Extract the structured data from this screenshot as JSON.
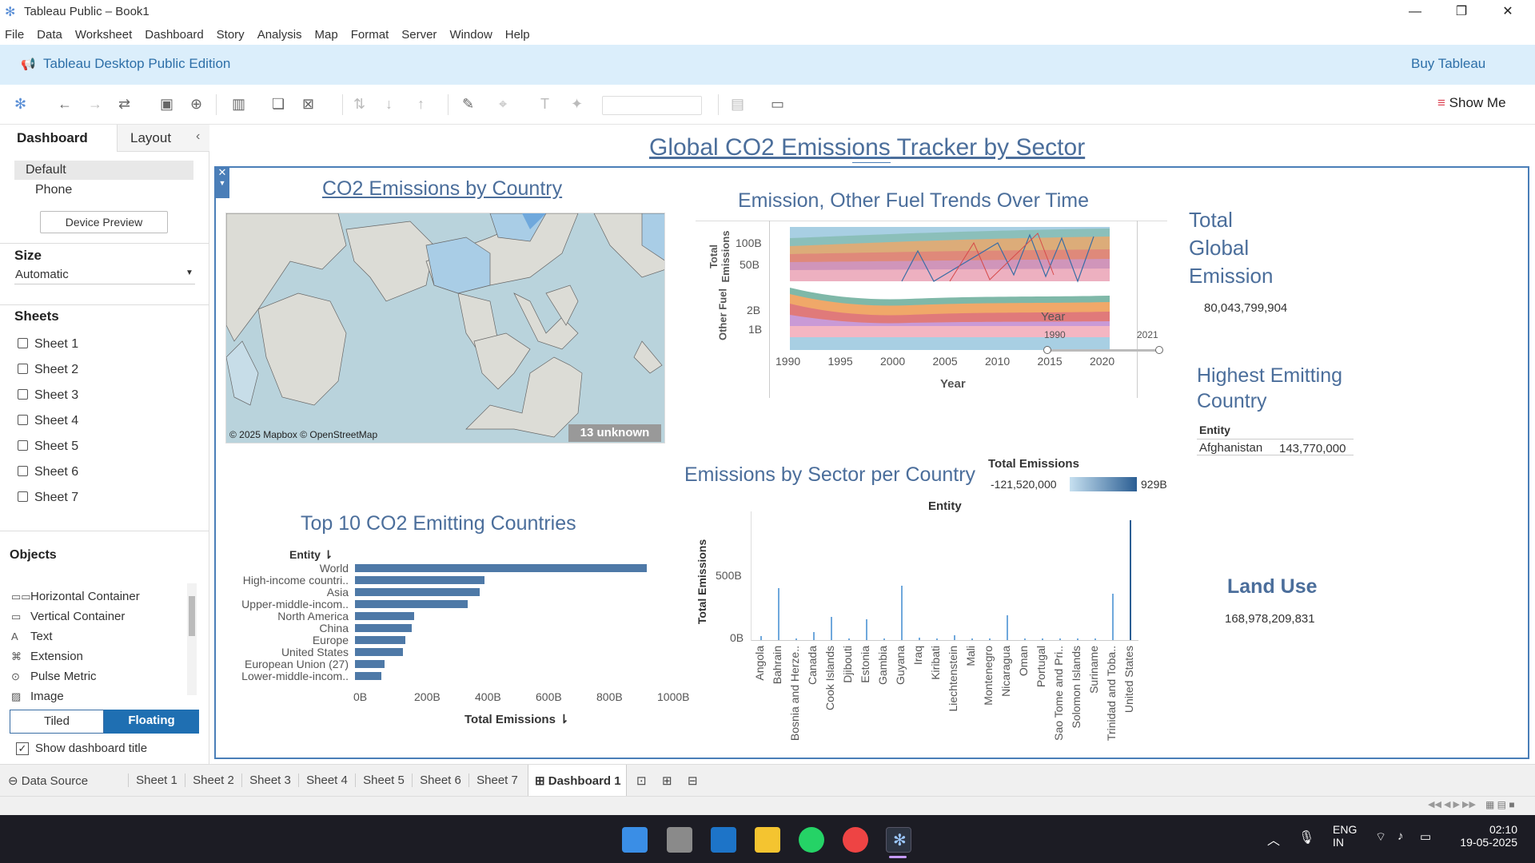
{
  "window": {
    "title": "Tableau Public – Book1"
  },
  "menu": [
    "File",
    "Data",
    "Worksheet",
    "Dashboard",
    "Story",
    "Analysis",
    "Map",
    "Format",
    "Server",
    "Window",
    "Help"
  ],
  "banner": {
    "edition": "Tableau Desktop Public Edition",
    "buy": "Buy Tableau"
  },
  "toolbar": {
    "show_me": "Show Me"
  },
  "left": {
    "tab_dashboard": "Dashboard",
    "tab_layout": "Layout",
    "devices": [
      "Default",
      "Phone"
    ],
    "device_preview": "Device Preview",
    "size_label": "Size",
    "size_value": "Automatic",
    "sheets_label": "Sheets",
    "sheets": [
      "Sheet 1",
      "Sheet 2",
      "Sheet 3",
      "Sheet 4",
      "Sheet 5",
      "Sheet 6",
      "Sheet 7"
    ],
    "objects_label": "Objects",
    "objects": [
      "Horizontal Container",
      "Vertical Container",
      "Text",
      "Extension",
      "Pulse Metric",
      "Image"
    ],
    "tiled": "Tiled",
    "floating": "Floating",
    "show_title": "Show dashboard title"
  },
  "dashboard": {
    "title": "Global CO2 Emissions Tracker by Sector",
    "map": {
      "title": "CO2 Emissions by Country",
      "attribution": "© 2025 Mapbox © OpenStreetMap",
      "unknown": "13 unknown"
    },
    "trend": {
      "title": "Emission, Other Fuel Trends Over Time",
      "y1_label": "Total Emissions",
      "y2_label": "Other Fuel",
      "y1_ticks": [
        "100B",
        "50B"
      ],
      "y2_ticks": [
        "2B",
        "1B"
      ],
      "x_label": "Year",
      "x_ticks": [
        "1990",
        "1995",
        "2000",
        "2005",
        "2010",
        "2015",
        "2020"
      ],
      "filter_label": "Year",
      "filter_min": "1990",
      "filter_max": "2021"
    },
    "kpi_total": {
      "title": "Total Global Emission",
      "value": "80,043,799,904"
    },
    "kpi_highest": {
      "title": "Highest Emitting Country",
      "col": "Entity",
      "country": "Afghanistan",
      "value": "143,770,000"
    },
    "kpi_land": {
      "title": "Land Use",
      "value": "168,978,209,831"
    },
    "sector": {
      "title": "Emissions by Sector per Country",
      "legend_title": "Total Emissions",
      "legend_min": "-121,520,000",
      "legend_max": "929B",
      "top_label": "Entity",
      "y_label": "Total Emissions",
      "y_ticks": [
        "500B",
        "0B"
      ]
    },
    "top10": {
      "title": "Top 10 CO2 Emitting Countries",
      "col": "Entity",
      "x_label": "Total Emissions",
      "x_ticks": [
        "0B",
        "200B",
        "400B",
        "600B",
        "800B",
        "1000B"
      ]
    }
  },
  "chart_data": [
    {
      "type": "bar",
      "title": "Top 10 CO2 Emitting Countries",
      "ylabel": "Entity",
      "xlabel": "Total Emissions",
      "categories": [
        "World",
        "High-income countri..",
        "Asia",
        "Upper-middle-incom..",
        "North America",
        "China",
        "Europe",
        "United States",
        "European Union (27)",
        "Lower-middle-incom.."
      ],
      "values": [
        980,
        435,
        420,
        380,
        200,
        190,
        170,
        160,
        100,
        90
      ],
      "units": "B",
      "xlim": [
        0,
        1000
      ]
    },
    {
      "type": "bar",
      "title": "Emissions by Sector per Country",
      "ylabel": "Total Emissions",
      "categories": [
        "Angola",
        "Bahrain",
        "Bosnia and Herze..",
        "Canada",
        "Cook Islands",
        "Djibouti",
        "Estonia",
        "Gambia",
        "Guyana",
        "Iraq",
        "Kiribati",
        "Liechtenstein",
        "Mali",
        "Montenegro",
        "Nicaragua",
        "Oman",
        "Portugal",
        "Sao Tome and Pri..",
        "Solomon Islands",
        "Suriname",
        "Trinidad and Toba..",
        "United States"
      ],
      "values": [
        30,
        400,
        10,
        60,
        180,
        10,
        160,
        10,
        420,
        20,
        15,
        40,
        10,
        10,
        190,
        15,
        10,
        10,
        10,
        10,
        360,
        929
      ],
      "units": "B",
      "ylim": [
        0,
        929
      ]
    }
  ],
  "tabs": {
    "datasource": "Data Source",
    "sheets": [
      "Sheet 1",
      "Sheet 2",
      "Sheet 3",
      "Sheet 4",
      "Sheet 5",
      "Sheet 6",
      "Sheet 7"
    ],
    "active": "Dashboard 1"
  },
  "taskbar": {
    "lang1": "ENG",
    "lang2": "IN",
    "time": "02:10",
    "date": "19-05-2025"
  }
}
